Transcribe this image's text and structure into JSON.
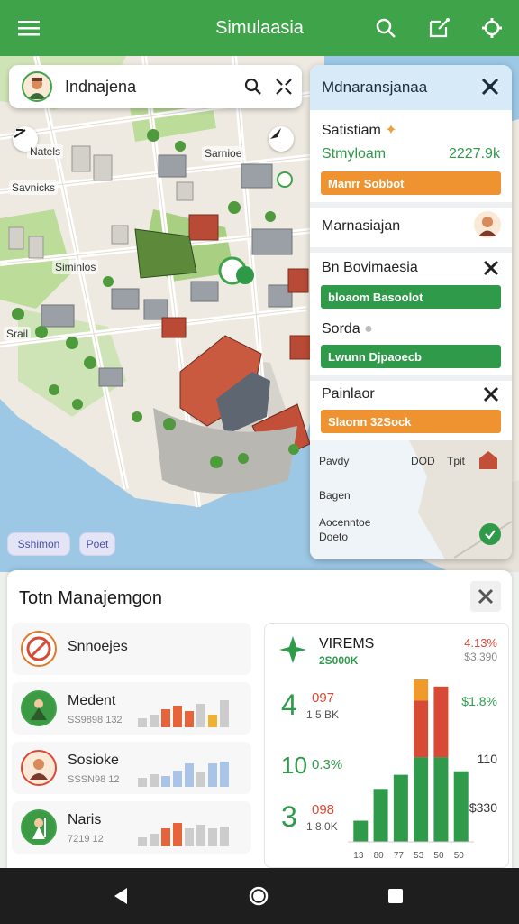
{
  "appbar": {
    "title": "Simulaasia",
    "menu_icon": "hamburger-icon",
    "search_icon": "search-icon",
    "edit_icon": "edit-square-icon",
    "settings_icon": "gear-icon",
    "color": "#3fa34a"
  },
  "search": {
    "text": "Indnajena"
  },
  "map": {
    "labels": [
      "Natels",
      "Sarnioe",
      "Savnicks",
      "Siminlos",
      "Srail"
    ],
    "chips": [
      "Sshimon",
      "Poet"
    ]
  },
  "panel": {
    "title": "Mdnaransjanaa",
    "res1": {
      "label": "Satistiam",
      "sub": "Stmyloam",
      "value": "2227.9k",
      "bar": "Manrr Sobbot"
    },
    "res2": {
      "label": "Marnasiajan"
    },
    "res3": {
      "label": "Bn Bovimaesia",
      "bar": "bloaom Basoolot"
    },
    "res4": {
      "label": "Sorda",
      "bar": "Lwunn Djpaoecb"
    },
    "res5": {
      "label": "Painlaor",
      "bar": "Slaonn 32Sock"
    },
    "footer": {
      "l1": "Pavdy",
      "l1b": "DOD",
      "l1c": "Tpit",
      "l2": "Bagen",
      "l3": "Aocenntoe",
      "l4": "Doeto"
    }
  },
  "bottom": {
    "title": "Totn Manajemgon",
    "items": [
      {
        "name": "Snnoejes",
        "sub": ""
      },
      {
        "name": "Medent",
        "sub": "SS9898 132"
      },
      {
        "name": "Sosioke",
        "sub": "SSSN98 12"
      },
      {
        "name": "Naris",
        "sub": "7219 12"
      }
    ],
    "stat": {
      "title": "VIREMS",
      "sub": "2S000K",
      "right1": "4.13%",
      "right2": "$3.390",
      "rows": [
        {
          "big": "4",
          "v": "097",
          "s": "1 5 BK",
          "r": "$1.8%"
        },
        {
          "big": "10",
          "v": "0.3%",
          "s": "",
          "r": "110"
        },
        {
          "big": "3",
          "v": "098",
          "s": "1 8.0K",
          "r": "$330"
        }
      ],
      "xticks": [
        "13",
        "80",
        "77",
        "53",
        "50",
        "50"
      ]
    }
  },
  "chart_data": {
    "type": "bar",
    "categories": [
      "13",
      "80",
      "77",
      "53",
      "50",
      "50"
    ],
    "series": [
      {
        "values": [
          12,
          30,
          38,
          48,
          48,
          40
        ]
      },
      {
        "values": [
          0,
          0,
          0,
          32,
          40,
          0
        ]
      },
      {
        "values": [
          0,
          0,
          0,
          12,
          0,
          0
        ]
      }
    ],
    "colors": [
      "#2f9a4a",
      "#d84a35",
      "#ef9a2a"
    ]
  },
  "navbar": {
    "back_icon": "back-triangle-icon",
    "home_icon": "home-circle-icon",
    "recents_icon": "recents-square-icon"
  }
}
